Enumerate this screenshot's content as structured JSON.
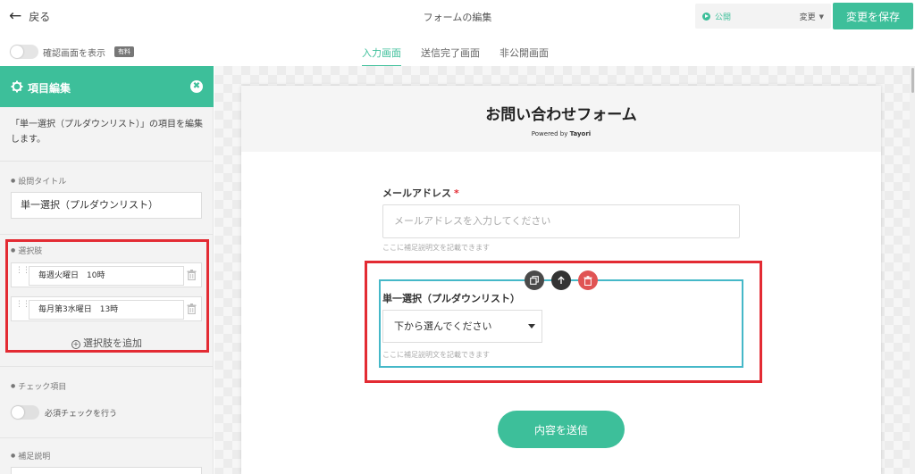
{
  "header": {
    "back_label": "戻る",
    "page_title": "フォームの編集",
    "status_label": "公開",
    "status_change_label": "変更",
    "save_label": "変更を保存"
  },
  "subheader": {
    "confirm_label": "確認画面を表示",
    "paid_badge": "有料",
    "tabs": [
      {
        "label": "入力画面",
        "active": true
      },
      {
        "label": "送信完了画面",
        "active": false
      },
      {
        "label": "非公開画面",
        "active": false
      }
    ]
  },
  "sidebar": {
    "panel_title": "項目編集",
    "description": "「単一選択（プルダウンリスト）」の項目を編集します。",
    "question_title_label": "設問タイトル",
    "question_title_value": "単一選択（プルダウンリスト）",
    "choices_label": "選択肢",
    "choices": [
      "毎週火曜日　10時",
      "毎月第3水曜日　13時"
    ],
    "add_choice_label": "選択肢を追加",
    "check_label": "チェック項目",
    "required_label": "必須チェックを行う",
    "supplement_label": "補足説明"
  },
  "form": {
    "title": "お問い合わせフォーム",
    "powered_prefix": "Powered by",
    "powered_brand": "Tayori",
    "email_label": "メールアドレス",
    "required_mark": "*",
    "email_placeholder": "メールアドレスを入力してください",
    "help_text": "ここに補足説明文を記載できます",
    "select_label": "単一選択（プルダウンリスト）",
    "select_placeholder": "下から選んでください",
    "submit_label": "内容を送信"
  },
  "colors": {
    "accent": "#3dbf9a",
    "highlight": "#e32b33",
    "selected_border": "#45b8c8"
  }
}
